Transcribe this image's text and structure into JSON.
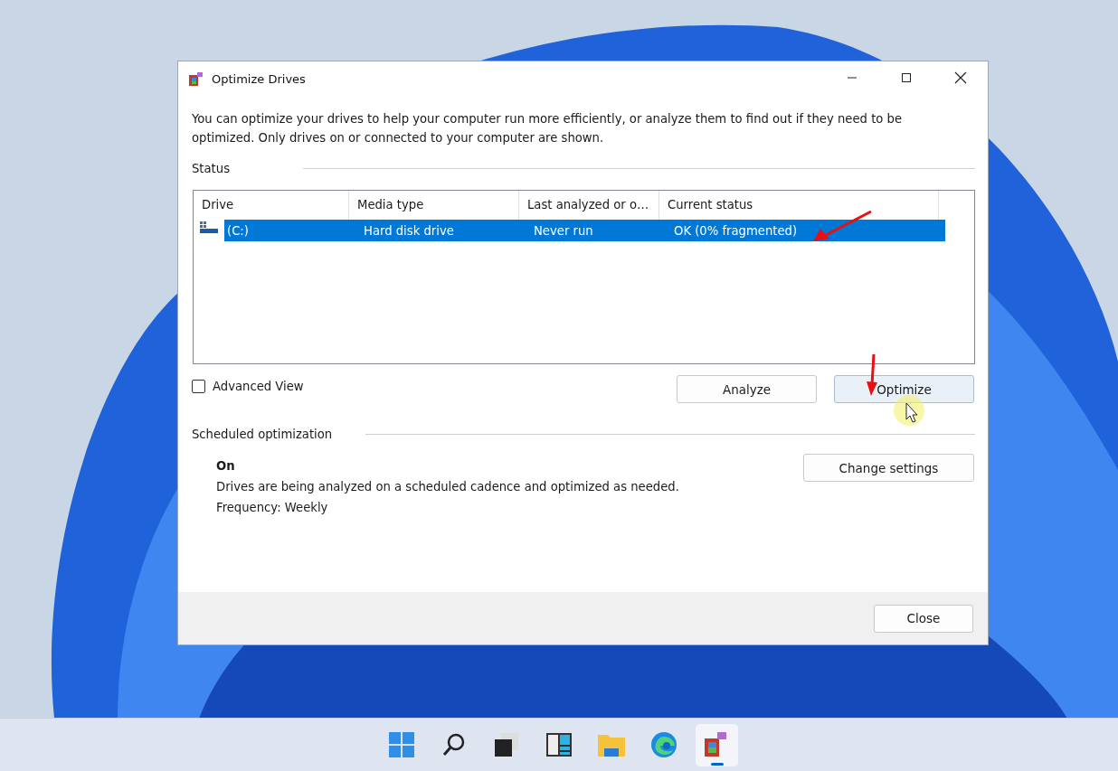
{
  "window": {
    "title": "Optimize Drives"
  },
  "intro": "You can optimize your drives to help your computer run more efficiently, or analyze them to find out if they need to be optimized. Only drives on or connected to your computer are shown.",
  "status": {
    "label": "Status",
    "table": {
      "columns": [
        "Drive",
        "Media type",
        "Last analyzed or o…",
        "Current status"
      ],
      "rows": [
        {
          "drive": "(C:)",
          "media_type": "Hard disk drive",
          "last_analyzed": "Never run",
          "current_status": "OK (0% fragmented)",
          "selected": true
        }
      ]
    }
  },
  "advanced_view": {
    "label": "Advanced View",
    "checked": false
  },
  "actions": [
    {
      "label": "Analyze",
      "hovered": false
    },
    {
      "label": "Optimize",
      "hovered": true
    }
  ],
  "scheduled": {
    "label": "Scheduled optimization",
    "state": "On",
    "description": "Drives are being analyzed on a scheduled cadence and optimized as needed.",
    "frequency": "Frequency: Weekly",
    "button": "Change settings"
  },
  "footer": {
    "button": "Close"
  },
  "taskbar": [
    {
      "kind": "start",
      "active": false
    },
    {
      "kind": "search",
      "active": false
    },
    {
      "kind": "taskview",
      "active": false
    },
    {
      "kind": "widgets",
      "active": false
    },
    {
      "kind": "explorer",
      "active": false
    },
    {
      "kind": "edge",
      "active": false
    },
    {
      "kind": "defrag",
      "active": true
    }
  ]
}
